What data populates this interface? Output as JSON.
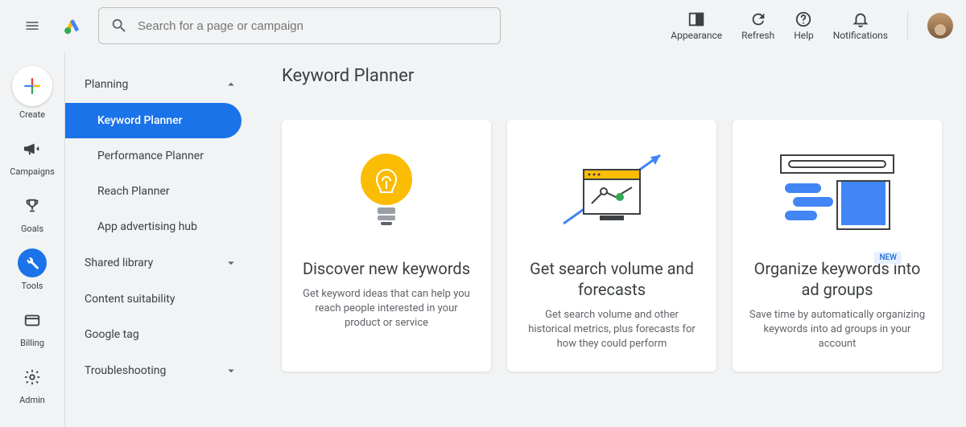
{
  "search": {
    "placeholder": "Search for a page or campaign"
  },
  "top_actions": {
    "appearance": "Appearance",
    "refresh": "Refresh",
    "help": "Help",
    "notifications": "Notifications"
  },
  "rail": {
    "create": "Create",
    "campaigns": "Campaigns",
    "goals": "Goals",
    "tools": "Tools",
    "billing": "Billing",
    "admin": "Admin"
  },
  "subpanel": {
    "planning": "Planning",
    "keyword_planner": "Keyword Planner",
    "performance_planner": "Performance Planner",
    "reach_planner": "Reach Planner",
    "app_advertising_hub": "App advertising hub",
    "shared_library": "Shared library",
    "content_suitability": "Content suitability",
    "google_tag": "Google tag",
    "troubleshooting": "Troubleshooting"
  },
  "page": {
    "title": "Keyword Planner"
  },
  "cards": [
    {
      "title": "Discover new keywords",
      "desc": "Get keyword ideas that can help you reach people interested in your product or service"
    },
    {
      "title": "Get search volume and forecasts",
      "desc": "Get search volume and other historical metrics, plus forecasts for how they could perform"
    },
    {
      "title": "Organize keywords into ad groups",
      "desc": "Save time by automatically organizing keywords into ad groups in your account",
      "badge": "NEW"
    }
  ]
}
